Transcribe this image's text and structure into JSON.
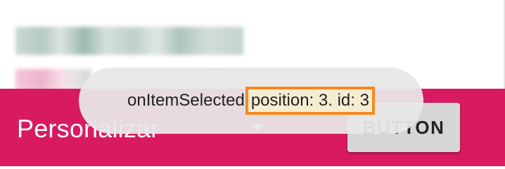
{
  "app_bar": {
    "title": "Personalizar",
    "button_label": "BUTTON",
    "background_color": "#d81b60",
    "dropdown_icon": "arrow-drop-down-icon"
  },
  "toast": {
    "text_prefix": "onItemSelected",
    "text_highlight": "position: 3. id: 3",
    "highlight_border_color": "#f58a1f"
  }
}
